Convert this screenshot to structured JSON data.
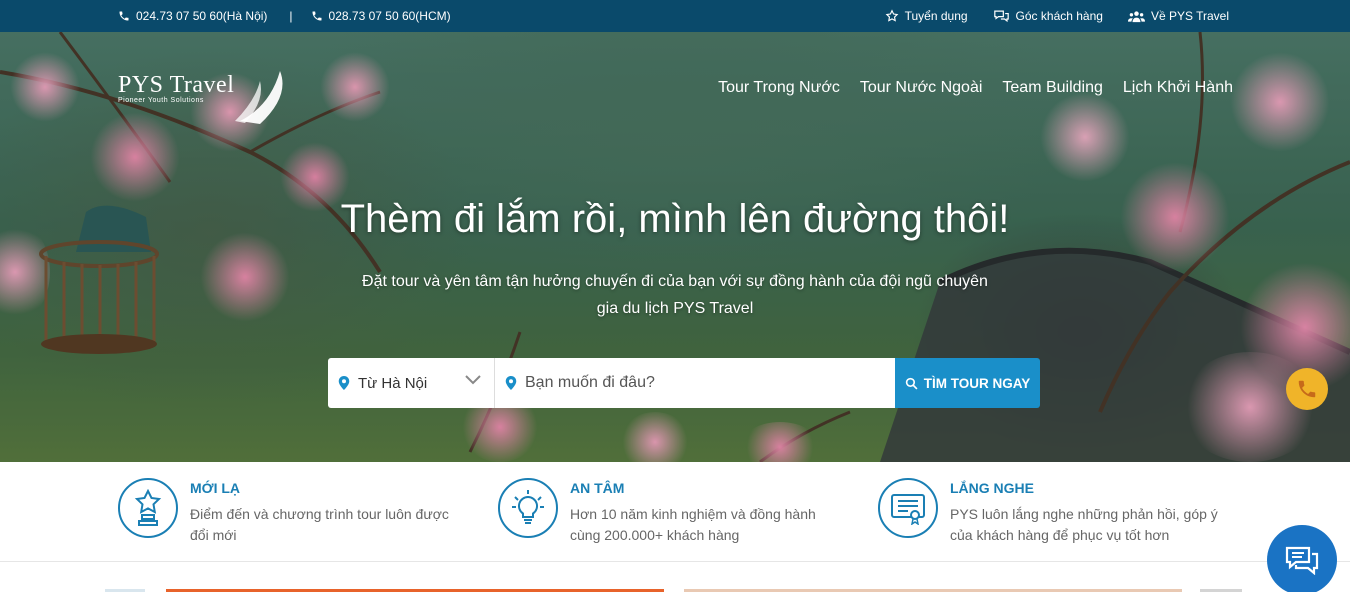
{
  "topbar": {
    "phone_hn": "024.73 07 50 60(Hà Nội)",
    "separator": "|",
    "phone_hcm": "028.73 07 50 60(HCM)",
    "links": [
      {
        "label": "Tuyển dụng",
        "icon": "star-icon"
      },
      {
        "label": "Góc khách hàng",
        "icon": "chat-icon"
      },
      {
        "label": "Về PYS Travel",
        "icon": "users-icon"
      }
    ]
  },
  "logo": {
    "name": "PYS Travel",
    "tagline": "Pioneer Youth Solutions"
  },
  "nav": [
    {
      "label": "Tour Trong Nước"
    },
    {
      "label": "Tour Nước Ngoài"
    },
    {
      "label": "Team Building"
    },
    {
      "label": "Lịch Khởi Hành"
    }
  ],
  "hero": {
    "headline": "Thèm đi lắm rồi, mình lên đường thôi!",
    "subline": "Đặt tour và yên tâm tận hưởng chuyến đi của bạn với sự đồng hành của đội ngũ chuyên gia du lịch PYS Travel"
  },
  "search": {
    "from_value": "Từ Hà Nội",
    "dest_placeholder": "Bạn muốn đi đâu?",
    "button_label": "TÌM TOUR NGAY"
  },
  "features": [
    {
      "title": "MỚI LẠ",
      "desc": "Điểm đến và chương trình tour luôn được đổi mới",
      "icon": "star-trophy-icon"
    },
    {
      "title": "AN TÂM",
      "desc": "Hơn 10 năm kinh nghiệm và đồng hành cùng 200.000+ khách hàng",
      "icon": "lightbulb-icon"
    },
    {
      "title": "LẮNG NGHE",
      "desc": "PYS luôn lắng nghe những phản hồi, góp ý của khách hàng để phục vụ tốt hơn",
      "icon": "certificate-icon"
    }
  ],
  "colors": {
    "topbar_bg": "#0a4a6b",
    "accent": "#1a8fc9",
    "feature_title": "#1a7fb4",
    "phone_fab": "#f0b429",
    "chat_fab": "#1a73c4"
  }
}
